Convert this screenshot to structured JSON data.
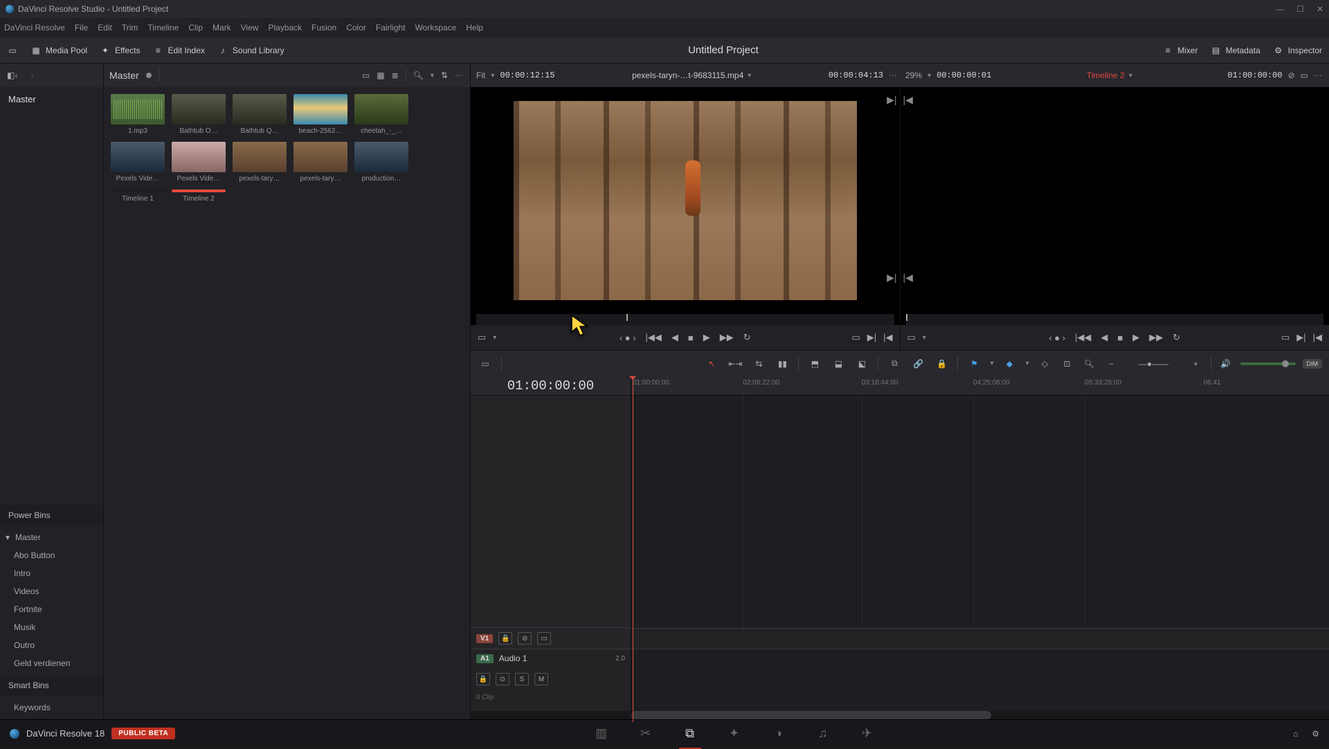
{
  "window": {
    "title": "DaVinci Resolve Studio - Untitled Project"
  },
  "menu": [
    "DaVinci Resolve",
    "File",
    "Edit",
    "Trim",
    "Timeline",
    "Clip",
    "Mark",
    "View",
    "Playback",
    "Fusion",
    "Color",
    "Fairlight",
    "Workspace",
    "Help"
  ],
  "toolstrip": {
    "left": {
      "mediapool": "Media Pool",
      "effects": "Effects",
      "editindex": "Edit Index",
      "soundlib": "Sound Library"
    },
    "project_title": "Untitled Project",
    "right": {
      "mixer": "Mixer",
      "metadata": "Metadata",
      "inspector": "Inspector"
    }
  },
  "sidebar": {
    "master": "Master",
    "powerbins": {
      "title": "Power Bins",
      "items": [
        "Master",
        "Abo Button",
        "Intro",
        "Videos",
        "Fortnite",
        "Musik",
        "Outro",
        "Geld verdienen"
      ]
    },
    "smartbins": {
      "title": "Smart Bins",
      "items": [
        "Keywords"
      ]
    }
  },
  "mediapool": {
    "bin": "Master",
    "clips": [
      {
        "label": "1.mp3",
        "type": "audio"
      },
      {
        "label": "Bathtub O…",
        "type": "video1"
      },
      {
        "label": "Bathtub Q…",
        "type": "video1"
      },
      {
        "label": "beach-2562…",
        "type": "beach"
      },
      {
        "label": "cheetah_-_…",
        "type": "forest"
      },
      {
        "label": "Pexels Vide…",
        "type": "video2"
      },
      {
        "label": "Pexels Vide…",
        "type": "people"
      },
      {
        "label": "pexels-tary…",
        "type": "forest-run"
      },
      {
        "label": "pexels-tary…",
        "type": "forest-run"
      },
      {
        "label": "production…",
        "type": "video2"
      },
      {
        "label": "Timeline 1",
        "type": "timeline"
      },
      {
        "label": "Timeline 2",
        "type": "timeline",
        "selected": true
      }
    ]
  },
  "viewers": {
    "source": {
      "fit": "Fit",
      "duration": "00:00:12:15",
      "name": "pexels-taryn-…t-9683115.mp4",
      "tc": "00:00:04:13"
    },
    "program": {
      "zoom": "29%",
      "duration": "00:00:00:01",
      "name": "Timeline 2",
      "tc": "01:00:00:00"
    }
  },
  "timeline": {
    "tc": "01:00:00:00",
    "ruler": [
      "01:00:00:00",
      "02:08:22:00",
      "03:16:44:00",
      "04:25:06:00",
      "05:33:28:00",
      "06:41"
    ],
    "tracks": {
      "v1": {
        "badge": "V1"
      },
      "a1": {
        "badge": "A1",
        "name": "Audio 1",
        "channels": "2.0",
        "clips": "0 Clip",
        "solo": "S",
        "mute": "M"
      }
    },
    "dim": "DIM"
  },
  "pagebar": {
    "app": "DaVinci Resolve 18",
    "beta": "PUBLIC BETA"
  }
}
